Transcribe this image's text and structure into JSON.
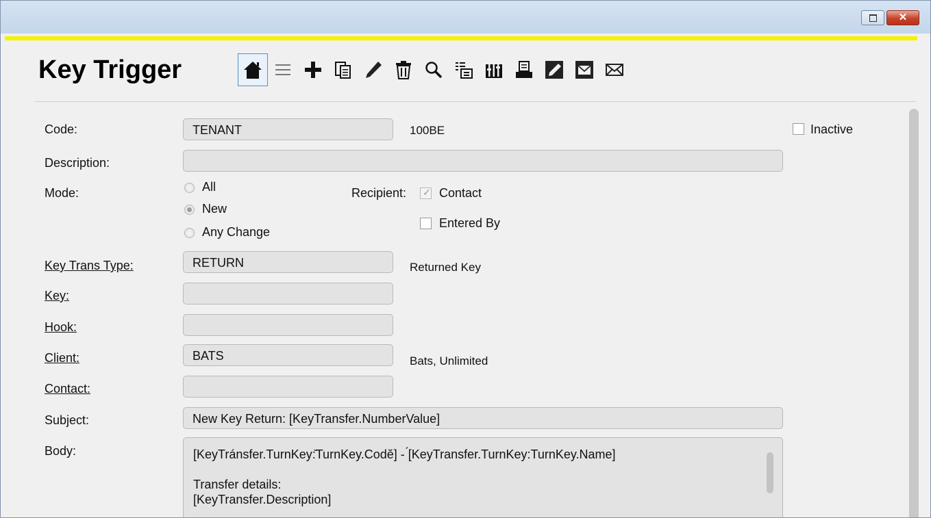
{
  "window": {
    "restore_label": "",
    "close_label": "✕"
  },
  "header": {
    "title": "Key Trigger"
  },
  "toolbar": [
    {
      "name": "home-icon"
    },
    {
      "name": "list-icon"
    },
    {
      "name": "add-icon"
    },
    {
      "name": "copy-icon"
    },
    {
      "name": "edit-icon"
    },
    {
      "name": "delete-icon"
    },
    {
      "name": "search-icon"
    },
    {
      "name": "sort-icon"
    },
    {
      "name": "columns-icon"
    },
    {
      "name": "print-icon"
    },
    {
      "name": "note-icon"
    },
    {
      "name": "email-preview-icon"
    },
    {
      "name": "email-icon"
    }
  ],
  "form": {
    "code_label": "Code:",
    "code_value": "TENANT",
    "code_desc": "100BE",
    "inactive_label": "Inactive",
    "description_label": "Description:",
    "description_value": "",
    "mode_label": "Mode:",
    "mode_options": [
      "All",
      "New",
      "Any Change"
    ],
    "mode_selected": "New",
    "recipient_label": "Recipient:",
    "recipient_contact_label": "Contact",
    "recipient_contact_checked": true,
    "recipient_entered_by_label": "Entered By",
    "recipient_entered_by_checked": false,
    "key_trans_type_label": "Key Trans Type:",
    "key_trans_type_value": "RETURN",
    "key_trans_type_desc": "Returned Key",
    "key_label": "Key:",
    "key_value": "",
    "hook_label": "Hook:",
    "hook_value": "",
    "client_label": "Client:",
    "client_value": "BATS",
    "client_desc": "Bats, Unlimited",
    "contact_label": "Contact:",
    "contact_value": "",
    "subject_label": "Subject:",
    "subject_value": "New Key Return: [KeyTransfer.NumberValue]",
    "body_label": "Body:",
    "body_lines": [
      "[KeyTránsfer.TurnKey:̆TurnKey.Codĕ] - ́[KeyTransfer.TurnKey:TurnKey.Name]",
      "",
      "Transfer details:",
      "[KeyTransfer.Description]"
    ]
  }
}
